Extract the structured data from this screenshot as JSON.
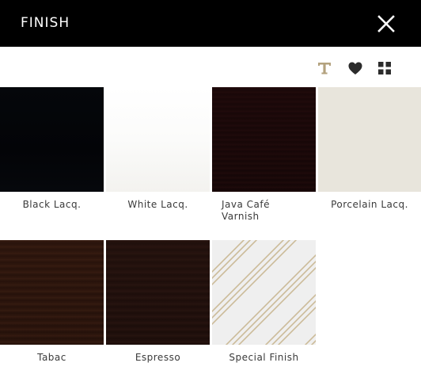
{
  "header": {
    "title": "FINISH",
    "close_icon": "close-icon"
  },
  "toolbar": {
    "icons": [
      "text-style-icon",
      "heart-icon",
      "grid-view-icon"
    ],
    "accent_color": "#b3a27e",
    "icon_color": "#2b2b2b"
  },
  "finishes": [
    {
      "label": "Black Lacq.",
      "color": "#04060a"
    },
    {
      "label": "White Lacq.",
      "color": "#fbfbfa"
    },
    {
      "label": "Java Café\nVarnish",
      "color": "#170708"
    },
    {
      "label": "Porcelain Lacq.",
      "color": "#e8e5dc"
    },
    {
      "label": "Tabac",
      "color": "#27120b"
    },
    {
      "label": "Espresso",
      "color": "#1e0f0b"
    },
    {
      "label": "Special Finish",
      "color": "#efefef"
    }
  ]
}
